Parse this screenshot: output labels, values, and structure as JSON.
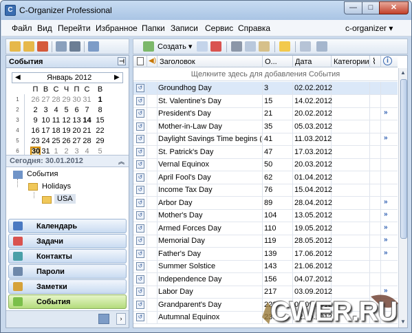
{
  "window": {
    "title": "C-Organizer Professional",
    "controls": [
      "—",
      "□",
      "✕"
    ]
  },
  "menu": {
    "items": [
      "Файл",
      "Вид",
      "Перейти",
      "Избранное",
      "Папки",
      "Записи",
      "Сервис",
      "Справка"
    ],
    "right": "c-organizer ▾"
  },
  "toolbar": {
    "create_label": "Создать ▾"
  },
  "left_panel": {
    "header": "События",
    "calendar": {
      "month": "Январь 2012",
      "weekdays": [
        "П",
        "В",
        "С",
        "Ч",
        "П",
        "С",
        "В"
      ],
      "weeks": [
        {
          "wk": "1",
          "days": [
            "26",
            "27",
            "28",
            "29",
            "30",
            "31",
            "1"
          ]
        },
        {
          "wk": "2",
          "days": [
            "2",
            "3",
            "4",
            "5",
            "6",
            "7",
            "8"
          ]
        },
        {
          "wk": "3",
          "days": [
            "9",
            "10",
            "11",
            "12",
            "13",
            "14",
            "15"
          ]
        },
        {
          "wk": "4",
          "days": [
            "16",
            "17",
            "18",
            "19",
            "20",
            "21",
            "22"
          ]
        },
        {
          "wk": "5",
          "days": [
            "23",
            "24",
            "25",
            "26",
            "27",
            "28",
            "29"
          ]
        },
        {
          "wk": "6",
          "days": [
            "30",
            "31",
            "1",
            "2",
            "3",
            "4",
            "5"
          ]
        }
      ]
    },
    "today": "Сегодня: 30.01.2012",
    "tree": {
      "root": "События",
      "folder": "Holidays",
      "sub": "USA"
    },
    "nav": [
      "Календарь",
      "Задачи",
      "Контакты",
      "Пароли",
      "Заметки",
      "События"
    ]
  },
  "grid": {
    "columns": {
      "title": "Заголовок",
      "num": "О...",
      "date": "Дата",
      "cat": "Категории"
    },
    "add_hint": "Щелкните здесь для добавления События",
    "rows": [
      {
        "title": "Groundhog Day",
        "num": "3",
        "date": "02.02.2012",
        "arrow": ""
      },
      {
        "title": "St. Valentine's Day",
        "num": "15",
        "date": "14.02.2012",
        "arrow": ""
      },
      {
        "title": "President's Day",
        "num": "21",
        "date": "20.02.2012",
        "arrow": "»"
      },
      {
        "title": "Mother-in-Law Day",
        "num": "35",
        "date": "05.03.2012",
        "arrow": ""
      },
      {
        "title": "Daylight Savings Time begins (...",
        "num": "41",
        "date": "11.03.2012",
        "arrow": "»"
      },
      {
        "title": "St. Patrick's Day",
        "num": "47",
        "date": "17.03.2012",
        "arrow": ""
      },
      {
        "title": "Vernal Equinox",
        "num": "50",
        "date": "20.03.2012",
        "arrow": ""
      },
      {
        "title": "April Fool's Day",
        "num": "62",
        "date": "01.04.2012",
        "arrow": ""
      },
      {
        "title": "Income Tax Day",
        "num": "76",
        "date": "15.04.2012",
        "arrow": ""
      },
      {
        "title": "Arbor Day",
        "num": "89",
        "date": "28.04.2012",
        "arrow": "»"
      },
      {
        "title": "Mother's Day",
        "num": "104",
        "date": "13.05.2012",
        "arrow": "»"
      },
      {
        "title": "Armed Forces Day",
        "num": "110",
        "date": "19.05.2012",
        "arrow": "»"
      },
      {
        "title": "Memorial Day",
        "num": "119",
        "date": "28.05.2012",
        "arrow": "»"
      },
      {
        "title": "Father's Day",
        "num": "139",
        "date": "17.06.2012",
        "arrow": "»"
      },
      {
        "title": "Summer Solstice",
        "num": "143",
        "date": "21.06.2012",
        "arrow": ""
      },
      {
        "title": "Independence Day",
        "num": "156",
        "date": "04.07.2012",
        "arrow": ""
      },
      {
        "title": "Labor Day",
        "num": "217",
        "date": "03.09.2012",
        "arrow": "»"
      },
      {
        "title": "Grandparent's Day",
        "num": "223",
        "date": "09.09.2012",
        "arrow": ""
      },
      {
        "title": "Autumnal Equinox",
        "num": "236",
        "date": "22.09.2012",
        "arrow": ""
      }
    ]
  },
  "watermark": "CWER.RU"
}
